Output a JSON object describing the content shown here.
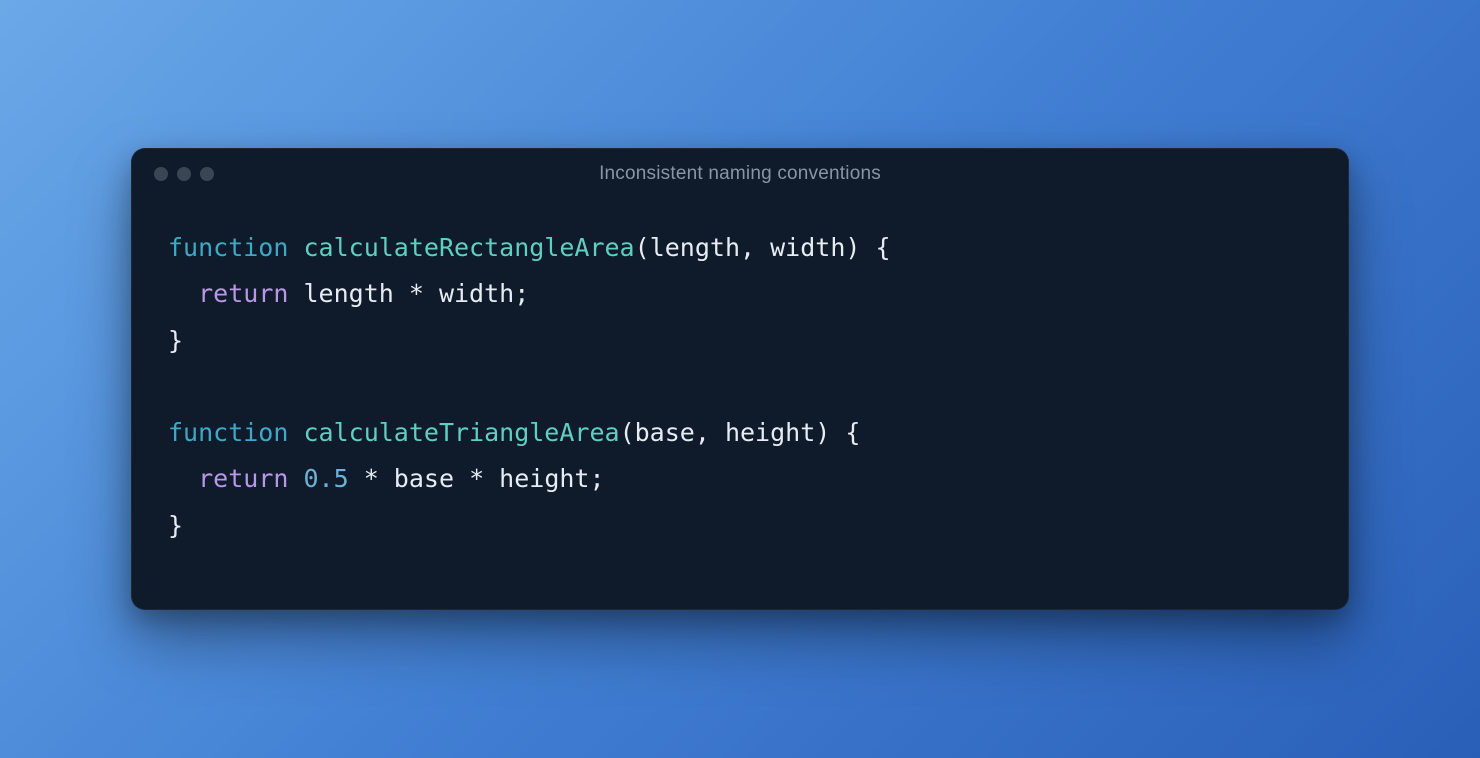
{
  "window": {
    "title": "Inconsistent naming conventions"
  },
  "code": {
    "functions": [
      {
        "keyword": "function",
        "name": "calculateRectangleArea",
        "params": [
          "length",
          "width"
        ],
        "body": {
          "return_keyword": "return",
          "expression_tokens": [
            {
              "type": "ident",
              "text": "length"
            },
            {
              "type": "op",
              "text": " * "
            },
            {
              "type": "ident",
              "text": "width"
            }
          ]
        }
      },
      {
        "keyword": "function",
        "name": "calculateTriangleArea",
        "params": [
          "base",
          "height"
        ],
        "body": {
          "return_keyword": "return",
          "expression_tokens": [
            {
              "type": "number",
              "text": "0.5"
            },
            {
              "type": "op",
              "text": " * "
            },
            {
              "type": "ident",
              "text": "base"
            },
            {
              "type": "op",
              "text": " * "
            },
            {
              "type": "ident",
              "text": "height"
            }
          ]
        }
      }
    ]
  }
}
